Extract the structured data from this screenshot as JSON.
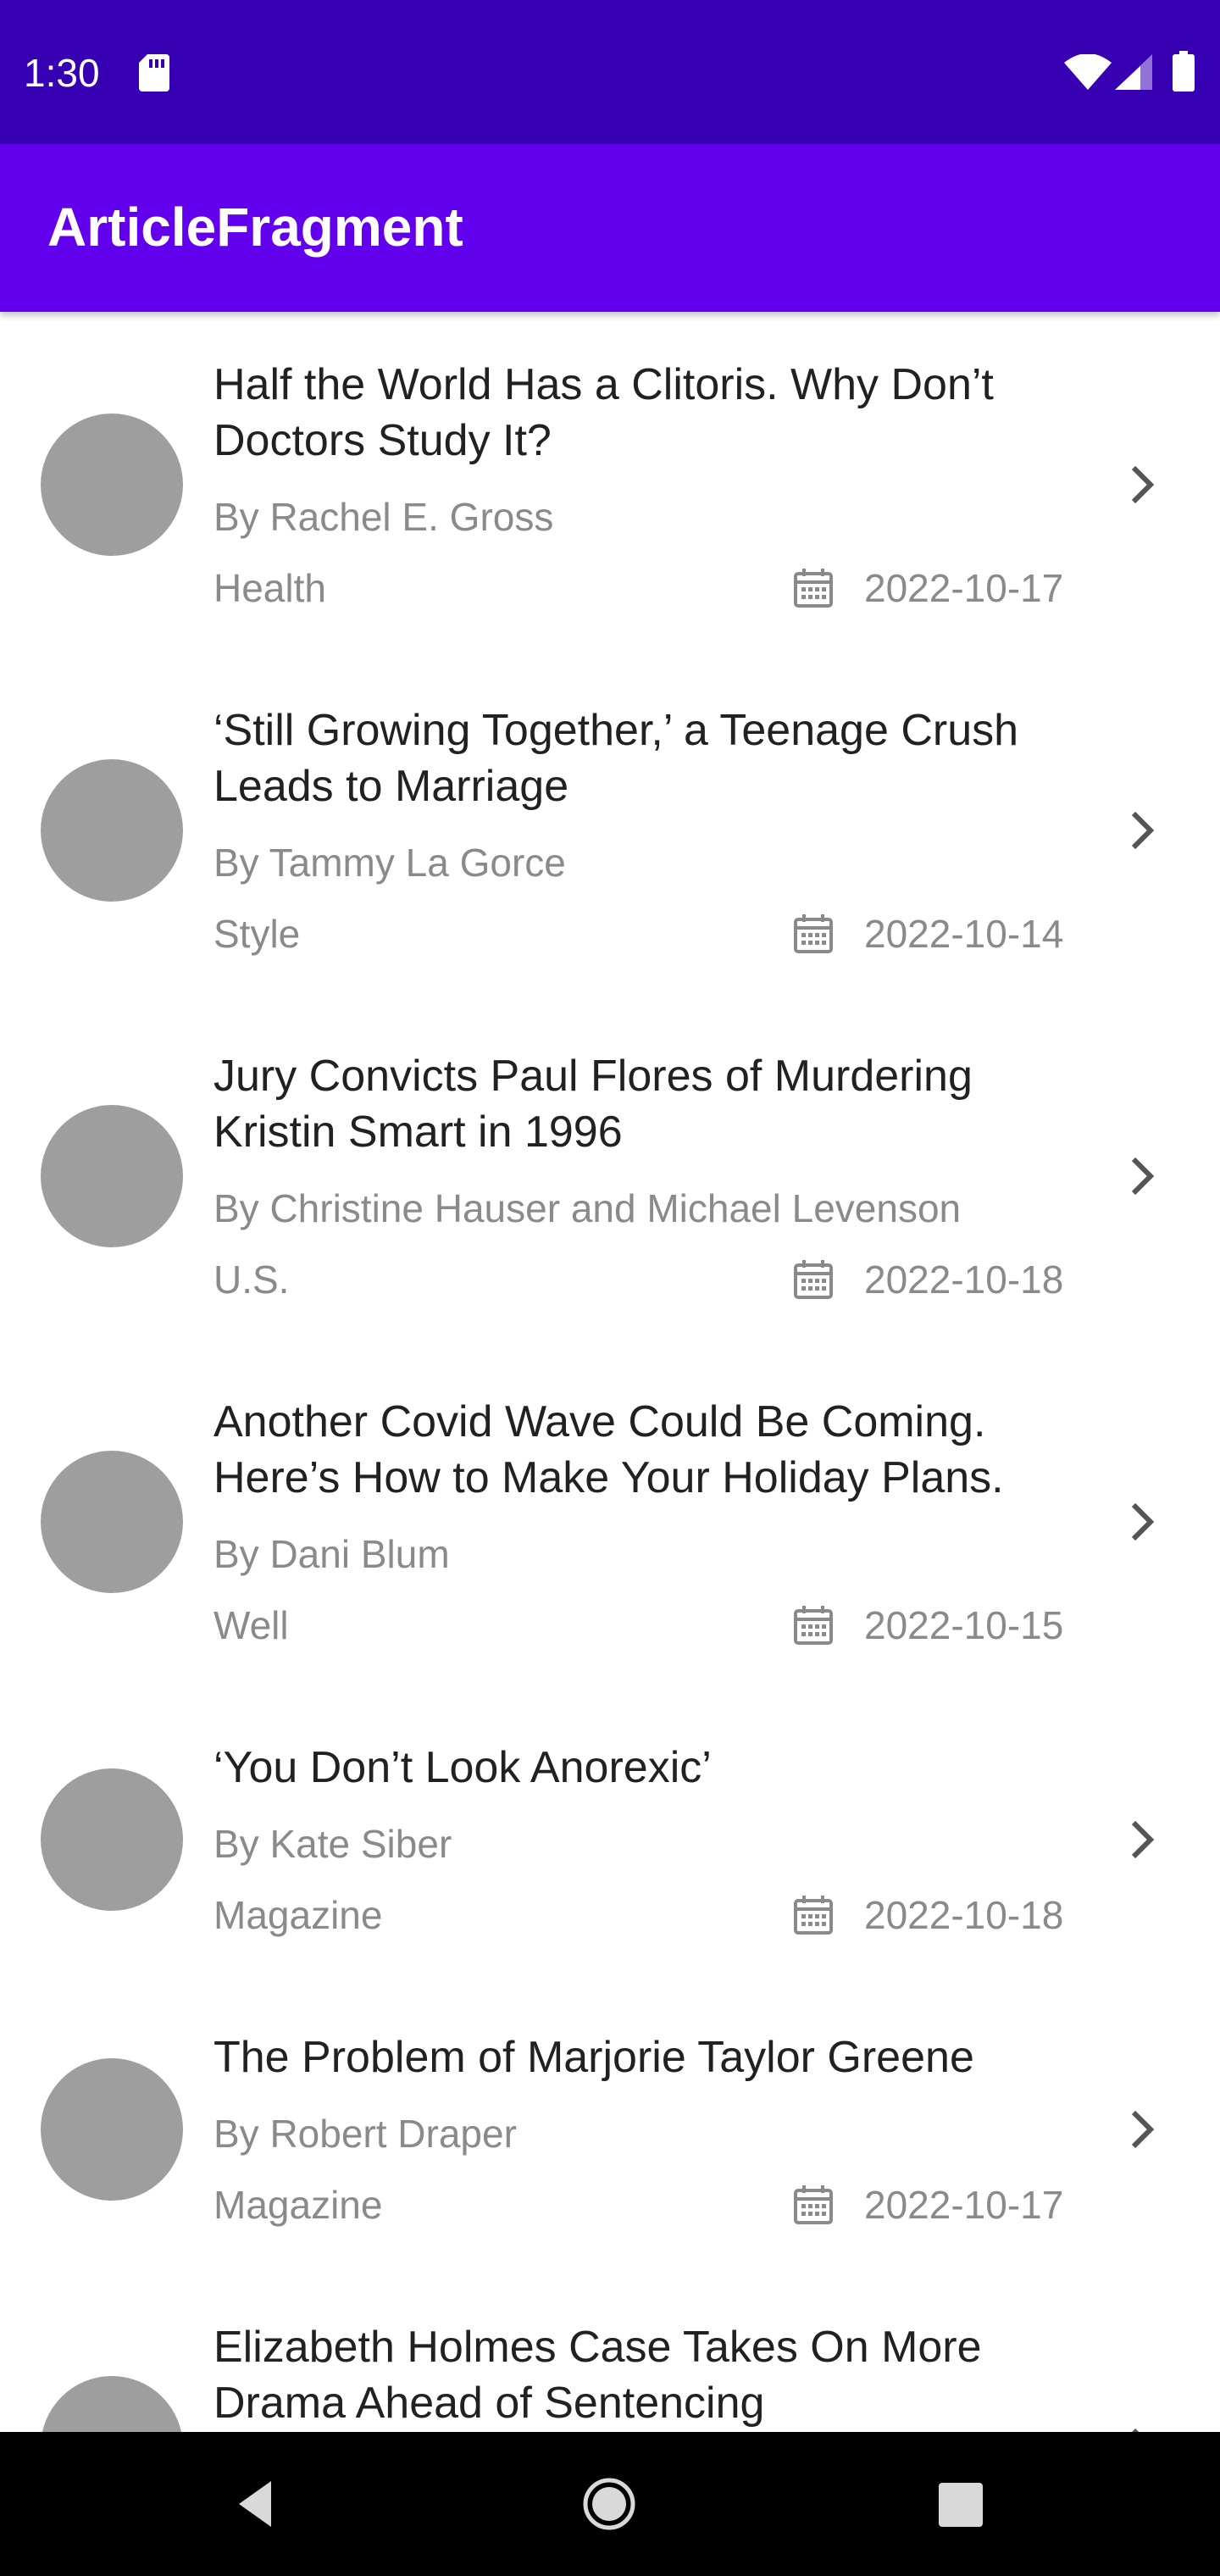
{
  "status_bar": {
    "time": "1:30"
  },
  "app_bar": {
    "title": "ArticleFragment"
  },
  "articles": [
    {
      "title": "Half the World Has a Clitoris. Why Don’t Doctors Study It?",
      "byline": "By Rachel E. Gross",
      "section": "Health",
      "date": "2022-10-17"
    },
    {
      "title": "‘Still Growing Together,’ a Teenage Crush Leads to Marriage",
      "byline": "By Tammy La Gorce",
      "section": "Style",
      "date": "2022-10-14"
    },
    {
      "title": "Jury Convicts Paul Flores of Murdering Kristin Smart in 1996",
      "byline": "By Christine Hauser and Michael Levenson",
      "section": "U.S.",
      "date": "2022-10-18"
    },
    {
      "title": "Another Covid Wave Could Be Coming. Here’s How to Make Your Holiday Plans.",
      "byline": "By Dani Blum",
      "section": "Well",
      "date": "2022-10-15"
    },
    {
      "title": "‘You Don’t Look Anorexic’",
      "byline": "By Kate Siber",
      "section": "Magazine",
      "date": "2022-10-18"
    },
    {
      "title": "The Problem of Marjorie Taylor Greene",
      "byline": "By Robert Draper",
      "section": "Magazine",
      "date": "2022-10-17"
    },
    {
      "title": "Elizabeth Holmes Case Takes On More Drama Ahead of Sentencing"
    }
  ],
  "colors": {
    "status_bar": "#3700b3",
    "app_bar": "#6200ee",
    "thumbnail_placeholder": "#9e9e9e",
    "secondary_text": "#8a8a8a"
  },
  "icons": {
    "status": [
      "sd-card-icon",
      "wifi-icon",
      "signal-icon",
      "battery-icon"
    ],
    "list_item": [
      "calendar-icon",
      "chevron-right-icon"
    ],
    "navigation": [
      "back-icon",
      "home-icon",
      "recents-icon"
    ]
  }
}
